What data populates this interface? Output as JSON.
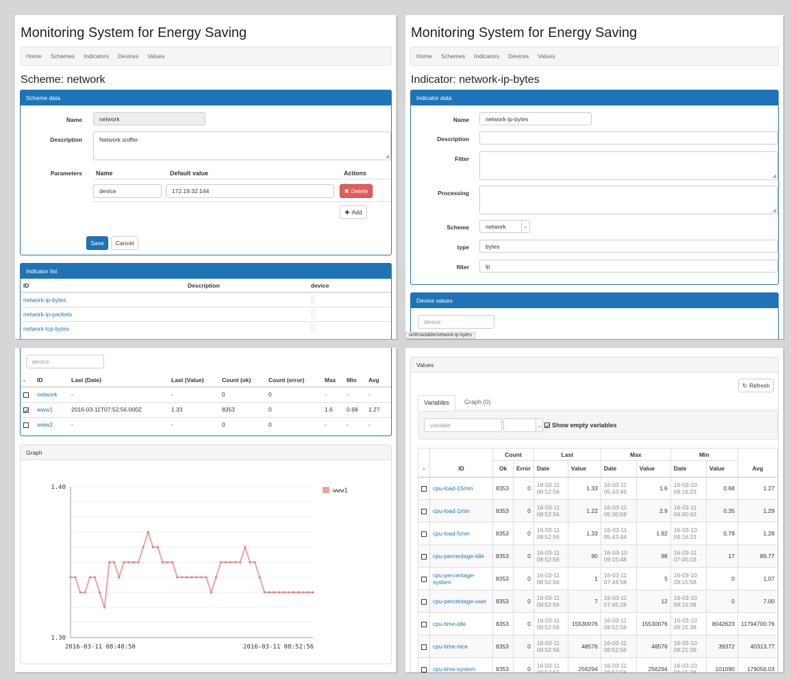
{
  "app_title": "Monitoring System for Energy Saving",
  "nav": [
    "Home",
    "Schemes",
    "Indicators",
    "Devices",
    "Values"
  ],
  "scheme": {
    "page_title": "Scheme: network",
    "panel_title": "Scheme data",
    "name_label": "Name",
    "name_value": "network",
    "desc_label": "Description",
    "desc_value": "Network sniffer",
    "params_label": "Parameters",
    "params_headers": [
      "Name",
      "Default value",
      "Actions"
    ],
    "param": {
      "name": "device",
      "default": "172.19.32.144"
    },
    "delete_label": "Delete",
    "add_label": "Add",
    "save_label": "Save",
    "cancel_label": "Cancel",
    "ind_panel_title": "Indicator list",
    "ind_headers": [
      "ID",
      "Description",
      "device"
    ],
    "indicators": [
      "network-ip-bytes",
      "network-ip-packets",
      "network-tcp-bytes"
    ]
  },
  "indicator": {
    "page_title": "Indicator: network-ip-bytes",
    "panel_title": "Indicator data",
    "name_label": "Name",
    "name_value": "network-ip-bytes",
    "desc_label": "Description",
    "filter_label": "Filter",
    "processing_label": "Processing",
    "scheme_label": "Scheme",
    "scheme_value": "network",
    "type_label": "type",
    "type_value": "bytes",
    "filter2_label": "filter",
    "filter2_value": "ip",
    "dv_panel_title": "Device values",
    "device_placeholder": "device",
    "status_url": "or/#/variable/network-ip-bytes"
  },
  "device_table": {
    "placeholder": "device",
    "headers": [
      "-",
      "ID",
      "Last (Date)",
      "Last (Value)",
      "Count (ok)",
      "Count (error)",
      "Max",
      "Min",
      "Avg"
    ],
    "rows": [
      {
        "checked": false,
        "id": "network",
        "date": "-",
        "value": "-",
        "ok": "0",
        "err": "0",
        "max": "-",
        "min": "-",
        "avg": "-"
      },
      {
        "checked": true,
        "id": "www1",
        "date": "2016-03-11T07:52:56.000Z",
        "value": "1.33",
        "ok": "8353",
        "err": "0",
        "max": "1.6",
        "min": "0.68",
        "avg": "1.27"
      },
      {
        "checked": false,
        "id": "www2",
        "date": "-",
        "value": "-",
        "ok": "0",
        "err": "0",
        "max": "-",
        "min": "-",
        "avg": "-"
      }
    ]
  },
  "graph": {
    "panel_title": "Graph",
    "legend": "www1",
    "color": "#f0a0a0"
  },
  "chart_data": {
    "type": "line",
    "series": [
      {
        "name": "www1",
        "values": [
          1.34,
          1.34,
          1.33,
          1.33,
          1.34,
          1.34,
          1.33,
          1.32,
          1.35,
          1.35,
          1.34,
          1.35,
          1.35,
          1.35,
          1.35,
          1.36,
          1.37,
          1.36,
          1.36,
          1.35,
          1.35,
          1.35,
          1.34,
          1.34,
          1.34,
          1.34,
          1.34,
          1.34,
          1.34,
          1.33,
          1.34,
          1.35,
          1.35,
          1.35,
          1.35,
          1.35,
          1.36,
          1.35,
          1.35,
          1.34,
          1.33,
          1.33,
          1.33,
          1.33,
          1.33,
          1.33,
          1.33,
          1.33,
          1.33,
          1.33,
          1.33
        ]
      }
    ],
    "xlabels": [
      "2016-03-11 08:48:50",
      "2016-03-11 08:52:56"
    ],
    "ylim": [
      1.3,
      1.4
    ],
    "yticks": [
      "1.40",
      "1.30"
    ],
    "grid": true,
    "legend": "top-right"
  },
  "values": {
    "panel_title": "Values",
    "refresh_label": "Refresh",
    "tabs": [
      "Variables",
      "Graph (0)"
    ],
    "var_placeholder": "variable",
    "show_empty_label": "Show empty variables",
    "group_headers": [
      "Count",
      "Last",
      "Max",
      "Min"
    ],
    "headers": [
      "-",
      "ID",
      "Ok",
      "Error",
      "Date",
      "Value",
      "Date",
      "Value",
      "Date",
      "Value",
      "Avg"
    ],
    "rows": [
      {
        "id": "cpu-load-15min",
        "ok": "8353",
        "err": "0",
        "ld1": "16-03-11",
        "ld2": "08:52:56",
        "lv": "1.33",
        "xd1": "16-03-11",
        "xd2": "05:43:49",
        "xv": "1.6",
        "nd1": "16-03-10",
        "nd2": "09:16:23",
        "nv": "0.68",
        "avg": "1.27"
      },
      {
        "id": "cpu-load-1min",
        "ok": "8353",
        "err": "0",
        "ld1": "16-03-11",
        "ld2": "08:52:56",
        "lv": "1.22",
        "xd1": "16-03-11",
        "xd2": "05:30:58",
        "xv": "2.9",
        "nd1": "16-03-11",
        "nd2": "04:00:43",
        "nv": "0.35",
        "avg": "1.29"
      },
      {
        "id": "cpu-load-5min",
        "ok": "8353",
        "err": "0",
        "ld1": "16-03-11",
        "ld2": "08:52:56",
        "lv": "1.33",
        "xd1": "16-03-11",
        "xd2": "05:43:44",
        "xv": "1.92",
        "nd1": "16-03-10",
        "nd2": "09:16:23",
        "nv": "0.78",
        "avg": "1.28"
      },
      {
        "id": "cpu-percentage-idle",
        "ok": "8353",
        "err": "0",
        "ld1": "16-03-11",
        "ld2": "08:52:56",
        "lv": "90",
        "xd1": "16-03-10",
        "xd2": "09:15:48",
        "xv": "98",
        "nd1": "16-03-11",
        "nd2": "07:45:03",
        "nv": "17",
        "avg": "89.77"
      },
      {
        "id": "cpu-percentage-system",
        "ok": "8353",
        "err": "0",
        "ld1": "16-03-11",
        "ld2": "08:52:56",
        "lv": "1",
        "xd1": "16-03-11",
        "xd2": "07:44:58",
        "xv": "5",
        "nd1": "16-03-10",
        "nd2": "09:15:58",
        "nv": "0",
        "avg": "1.07"
      },
      {
        "id": "cpu-percentage-user",
        "ok": "8353",
        "err": "0",
        "ld1": "16-03-11",
        "ld2": "08:52:56",
        "lv": "7",
        "xd1": "16-03-11",
        "xd2": "07:45:28",
        "xv": "12",
        "nd1": "16-03-10",
        "nd2": "09:15:38",
        "nv": "0",
        "avg": "7.00"
      },
      {
        "id": "cpu-time-idle",
        "ok": "8353",
        "err": "0",
        "ld1": "16-03-11",
        "ld2": "08:52:56",
        "lv": "15530076",
        "xd1": "16-03-11",
        "xd2": "08:52:56",
        "xv": "15530076",
        "nd1": "16-03-10",
        "nd2": "09:15:38",
        "nv": "8042623",
        "avg": "11794700.76"
      },
      {
        "id": "cpu-time-nice",
        "ok": "8353",
        "err": "0",
        "ld1": "16-03-11",
        "ld2": "08:52:56",
        "lv": "48576",
        "xd1": "16-03-11",
        "xd2": "08:52:56",
        "xv": "48576",
        "nd1": "16-03-10",
        "nd2": "09:21:39",
        "nv": "39372",
        "avg": "40313.77"
      },
      {
        "id": "cpu-time-system",
        "ok": "8353",
        "err": "0",
        "ld1": "16-03-11",
        "ld2": "08:52:56",
        "lv": "256294",
        "xd1": "16-03-11",
        "xd2": "08:52:56",
        "xv": "256294",
        "nd1": "16-03-10",
        "nd2": "09:15:38",
        "nv": "101090",
        "avg": "179056.03"
      }
    ]
  }
}
